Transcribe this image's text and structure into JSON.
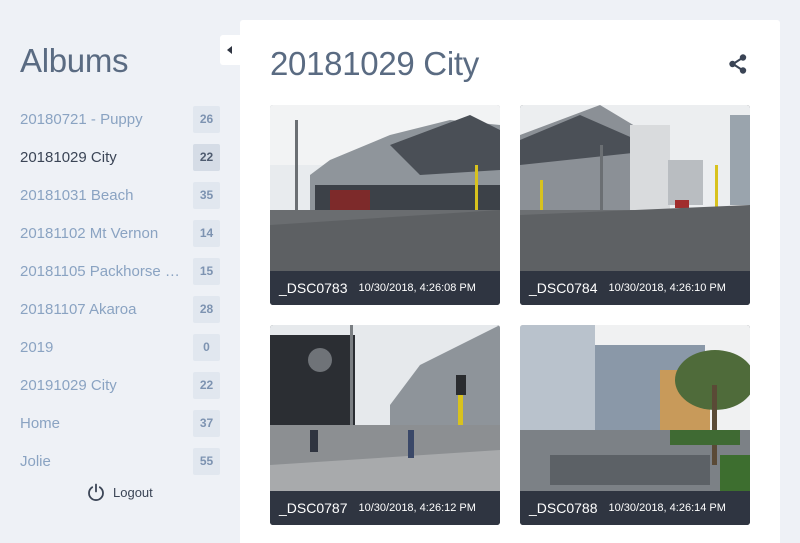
{
  "sidebar": {
    "title": "Albums",
    "albums": [
      {
        "name": "20180721 - Puppy",
        "count": "26"
      },
      {
        "name": "20181029 City",
        "count": "22"
      },
      {
        "name": "20181031 Beach",
        "count": "35"
      },
      {
        "name": "20181102 Mt Vernon",
        "count": "14"
      },
      {
        "name": "20181105 Packhorse …",
        "count": "15"
      },
      {
        "name": "20181107 Akaroa",
        "count": "28"
      },
      {
        "name": "2019",
        "count": "0"
      },
      {
        "name": "20191029 City",
        "count": "22"
      },
      {
        "name": "Home",
        "count": "37"
      },
      {
        "name": "Jolie",
        "count": "55"
      }
    ],
    "active_album": "20181029 City",
    "logout_label": "Logout"
  },
  "main": {
    "title": "20181029 City",
    "photos": [
      {
        "name": "_DSC0783",
        "date": "10/30/2018, 4:26:08 PM"
      },
      {
        "name": "_DSC0784",
        "date": "10/30/2018, 4:26:10 PM"
      },
      {
        "name": "_DSC0787",
        "date": "10/30/2018, 4:26:12 PM"
      },
      {
        "name": "_DSC0788",
        "date": "10/30/2018, 4:26:14 PM"
      }
    ]
  },
  "icons": {
    "share": "share-icon",
    "logout": "power-icon",
    "collapse": "caret-left-icon"
  },
  "colors": {
    "background": "#eef1f6",
    "panel": "#ffffff",
    "caption_bar": "#2f3541",
    "link_text": "#8aa3c2",
    "active_text": "#3b4556",
    "badge": "#e1e7ef"
  }
}
